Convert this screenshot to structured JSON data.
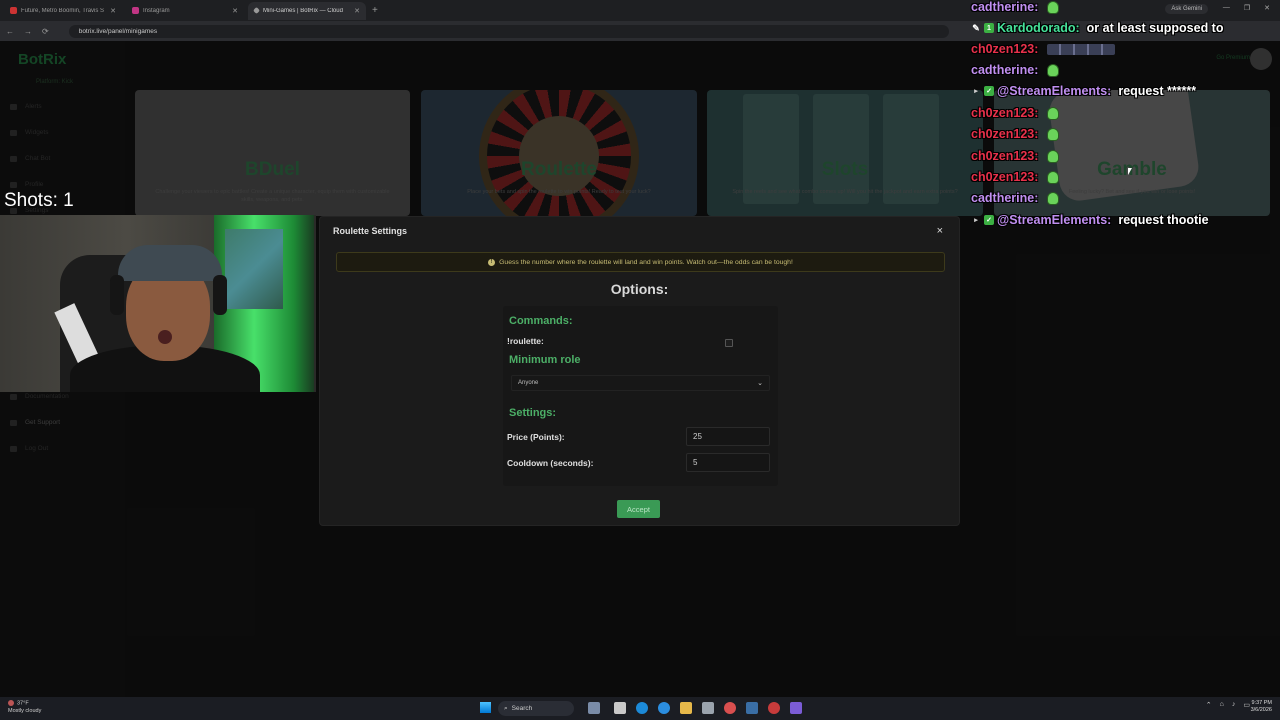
{
  "browser": {
    "tabs": [
      {
        "title": "Future, Metro Boomin, Travis S",
        "active": false,
        "favicon": "youtube-icon"
      },
      {
        "title": "Instagram",
        "active": false,
        "favicon": "instagram-icon"
      },
      {
        "title": "Mini-Games | BotRix — Cloud",
        "active": true,
        "favicon": "botrix-icon"
      }
    ],
    "url": "botrix.live/panel/minigames",
    "gemini": "Ask Gemini"
  },
  "app": {
    "brand": "BotRix",
    "platform": "Platform: Kick",
    "premium": "Go Premium",
    "sidebar": [
      "Alerts",
      "Widgets",
      "Chat Bot",
      "Profile",
      "Settings",
      "Documentation",
      "Get Support",
      "Log Out"
    ],
    "cards": [
      {
        "title": "BDuel",
        "desc": "Challenge your viewers to epic battles! Create a unique character, equip them with customizable skills, weapons, and pets."
      },
      {
        "title": "Roulette",
        "desc": "Place your bets and spin the roulette to win points! Ready to test your luck?"
      },
      {
        "title": "Slots",
        "desc": "Spin the reels and see what combo comes up! Will you hit the jackpot and earn extra points?"
      },
      {
        "title": "Gamble",
        "desc": "Feeling lucky? Bet and see if you win or lose points!"
      }
    ]
  },
  "modal": {
    "title": "Roulette Settings",
    "close": "×",
    "alert": "Guess the number where the roulette will land and win points. Watch out—the odds can be tough!",
    "options_heading": "Options:",
    "commands_heading": "Commands:",
    "command": "!roulette:",
    "min_role_heading": "Minimum role",
    "min_role_value": "Anyone",
    "settings_heading": "Settings:",
    "price_label": "Price (Points):",
    "price_value": "25",
    "cooldown_label": "Cooldown (seconds):",
    "cooldown_value": "5",
    "accept": "Accept"
  },
  "overlay": {
    "shots": "Shots: 1"
  },
  "chat": [
    {
      "user": "cadtherine:",
      "color": "#c08ff0",
      "text": "",
      "emote": "green-ghost-emote",
      "badges": []
    },
    {
      "user": "Kardodorado:",
      "color": "#46e29a",
      "text": "or at least supposed to",
      "emote": "",
      "badges": [
        "pencil",
        "one"
      ]
    },
    {
      "user": "ch0zen123:",
      "color": "#e8314b",
      "text": "",
      "emote": "emote-strip",
      "badges": []
    },
    {
      "user": "cadtherine:",
      "color": "#c08ff0",
      "text": "",
      "emote": "green-ghost-emote",
      "badges": []
    },
    {
      "user": "@StreamElements:",
      "color": "#c08ff0",
      "text": "request ******",
      "emote": "",
      "badges": [
        "cam",
        "check"
      ]
    },
    {
      "user": "ch0zen123:",
      "color": "#e8314b",
      "text": "",
      "emote": "green-ghost-emote",
      "badges": []
    },
    {
      "user": "ch0zen123:",
      "color": "#e8314b",
      "text": "",
      "emote": "green-ghost-emote",
      "badges": []
    },
    {
      "user": "ch0zen123:",
      "color": "#e8314b",
      "text": "",
      "emote": "green-ghost-emote",
      "badges": []
    },
    {
      "user": "ch0zen123:",
      "color": "#e8314b",
      "text": "",
      "emote": "green-ghost-emote",
      "badges": []
    },
    {
      "user": "cadtherine:",
      "color": "#c08ff0",
      "text": "",
      "emote": "green-ghost-emote",
      "badges": []
    },
    {
      "user": "@StreamElements:",
      "color": "#c08ff0",
      "text": "request thootie",
      "emote": "",
      "badges": [
        "cam",
        "check"
      ]
    }
  ],
  "taskbar": {
    "weather_temp": "37°F",
    "weather_desc": "Mostly cloudy",
    "search": "Search",
    "time": "9:37 PM",
    "date": "3/6/2026"
  }
}
